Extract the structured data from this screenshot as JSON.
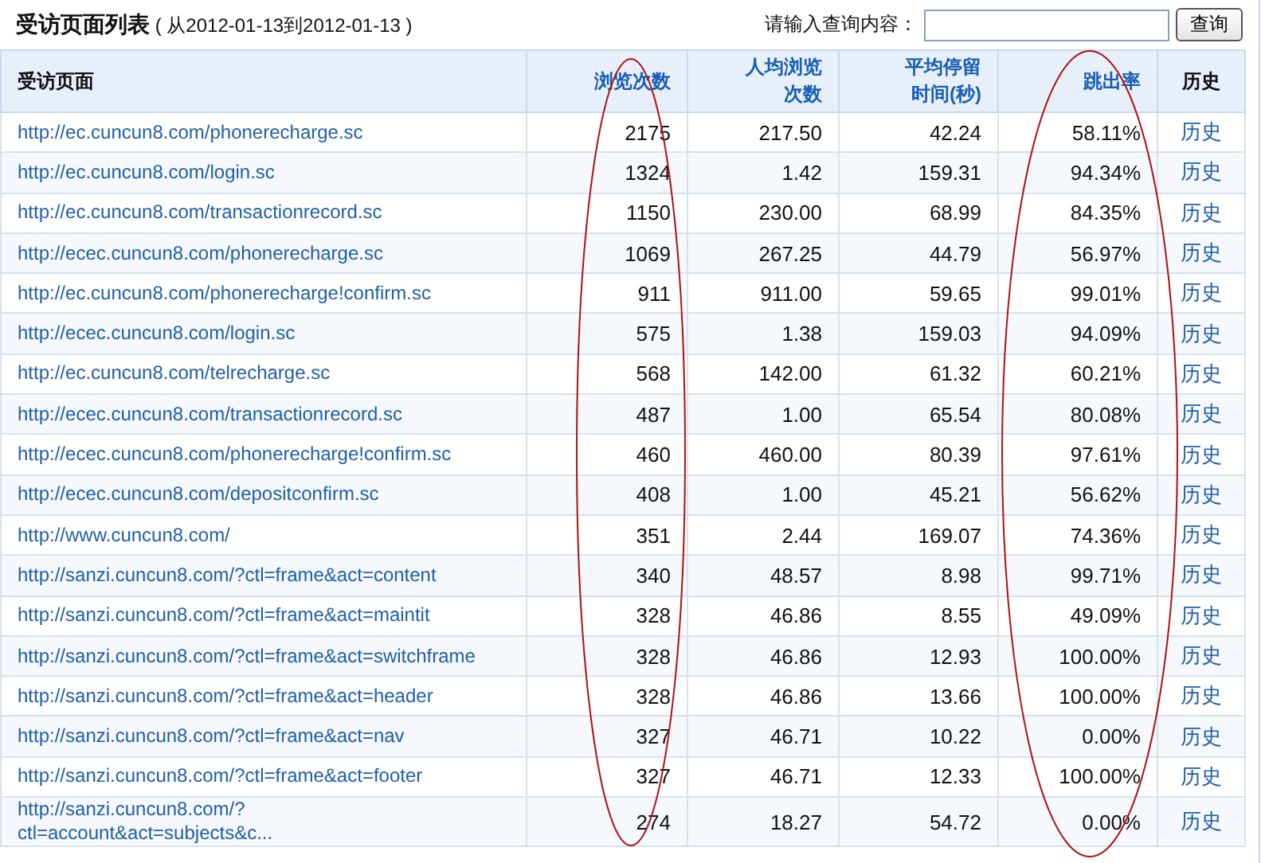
{
  "header": {
    "title": "受访页面列表",
    "date_range": "( 从2012-01-13到2012-01-13 )",
    "search_label": "请输入查询内容：",
    "search_button": "查询"
  },
  "table": {
    "columns": [
      {
        "label": "受访页面",
        "kind": "plain"
      },
      {
        "label": "浏览次数",
        "kind": "sort"
      },
      {
        "label": "人均浏览次数",
        "kind": "sort"
      },
      {
        "label": "平均停留时间(秒)",
        "kind": "sort"
      },
      {
        "label": "跳出率",
        "kind": "sort"
      },
      {
        "label": "历史",
        "kind": "plain"
      }
    ],
    "rows": [
      [
        "http://ec.cuncun8.com/phonerecharge.sc",
        "2175",
        "217.50",
        "42.24",
        "58.11%",
        "历史"
      ],
      [
        "http://ec.cuncun8.com/login.sc",
        "1324",
        "1.42",
        "159.31",
        "94.34%",
        "历史"
      ],
      [
        "http://ec.cuncun8.com/transactionrecord.sc",
        "1150",
        "230.00",
        "68.99",
        "84.35%",
        "历史"
      ],
      [
        "http://ecec.cuncun8.com/phonerecharge.sc",
        "1069",
        "267.25",
        "44.79",
        "56.97%",
        "历史"
      ],
      [
        "http://ec.cuncun8.com/phonerecharge!confirm.sc",
        "911",
        "911.00",
        "59.65",
        "99.01%",
        "历史"
      ],
      [
        "http://ecec.cuncun8.com/login.sc",
        "575",
        "1.38",
        "159.03",
        "94.09%",
        "历史"
      ],
      [
        "http://ec.cuncun8.com/telrecharge.sc",
        "568",
        "142.00",
        "61.32",
        "60.21%",
        "历史"
      ],
      [
        "http://ecec.cuncun8.com/transactionrecord.sc",
        "487",
        "1.00",
        "65.54",
        "80.08%",
        "历史"
      ],
      [
        "http://ecec.cuncun8.com/phonerecharge!confirm.sc",
        "460",
        "460.00",
        "80.39",
        "97.61%",
        "历史"
      ],
      [
        "http://ecec.cuncun8.com/depositconfirm.sc",
        "408",
        "1.00",
        "45.21",
        "56.62%",
        "历史"
      ],
      [
        "http://www.cuncun8.com/",
        "351",
        "2.44",
        "169.07",
        "74.36%",
        "历史"
      ],
      [
        "http://sanzi.cuncun8.com/?ctl=frame&act=content",
        "340",
        "48.57",
        "8.98",
        "99.71%",
        "历史"
      ],
      [
        "http://sanzi.cuncun8.com/?ctl=frame&act=maintit",
        "328",
        "46.86",
        "8.55",
        "49.09%",
        "历史"
      ],
      [
        "http://sanzi.cuncun8.com/?ctl=frame&act=switchframe",
        "328",
        "46.86",
        "12.93",
        "100.00%",
        "历史"
      ],
      [
        "http://sanzi.cuncun8.com/?ctl=frame&act=header",
        "328",
        "46.86",
        "13.66",
        "100.00%",
        "历史"
      ],
      [
        "http://sanzi.cuncun8.com/?ctl=frame&act=nav",
        "327",
        "46.71",
        "10.22",
        "0.00%",
        "历史"
      ],
      [
        "http://sanzi.cuncun8.com/?ctl=frame&act=footer",
        "327",
        "46.71",
        "12.33",
        "100.00%",
        "历史"
      ],
      [
        "http://sanzi.cuncun8.com/?ctl=account&act=subjects&c...",
        "274",
        "18.27",
        "54.72",
        "0.00%",
        "历史"
      ]
    ]
  }
}
